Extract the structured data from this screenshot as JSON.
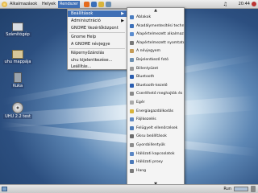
{
  "top_panel": {
    "menus": [
      "Alkalmazások",
      "Helyek",
      "Rendszer"
    ],
    "clock": "20:44"
  },
  "desktop_icons": [
    {
      "label": "Számítógép",
      "icon": "computer-icon"
    },
    {
      "label": "uhu mappája",
      "icon": "home-folder-icon"
    },
    {
      "label": "Kuka",
      "icon": "trash-icon"
    },
    {
      "label": "UHU 2.2 test",
      "icon": "cd-disc-icon"
    }
  ],
  "system_menu": {
    "items": [
      "Beállítások",
      "Adminisztráció",
      "GNOME Vezérlőközpont",
      "Gnome Help",
      "A GNOME névjegye",
      "Képernyőzárolás",
      "uhu kijelentkezése...",
      "Leállítás..."
    ],
    "highlighted_index": 0
  },
  "preferences_menu": {
    "items": [
      {
        "label": "Ablakok",
        "icon": "windows-icon",
        "color": "#4a7cc0"
      },
      {
        "label": "Akadálymentesítési technológiák",
        "icon": "accessibility-icon",
        "color": "#3b6fb8"
      },
      {
        "label": "Alapértelmezett alkalmazások",
        "icon": "default-apps-icon",
        "color": "#5a8ccf"
      },
      {
        "label": "Alapértelmezett nyomtató",
        "icon": "printer-icon",
        "color": "#777777"
      },
      {
        "label": "A névjegyem",
        "icon": "about-me-icon",
        "color": "#c49b56"
      },
      {
        "label": "Bejelentkező fotó",
        "icon": "login-photo-icon",
        "color": "#6d8fb0"
      },
      {
        "label": "Billentyűzet",
        "icon": "keyboard-icon",
        "color": "#999999"
      },
      {
        "label": "Bluetooth",
        "icon": "bluetooth-icon",
        "color": "#2a5db0"
      },
      {
        "label": "Bluetooth-kezelő",
        "icon": "bluetooth-manager-icon",
        "color": "#2a5db0"
      },
      {
        "label": "Cserélhető meghajtók és adathordozók",
        "icon": "removable-drive-icon",
        "color": "#8a8a8a"
      },
      {
        "label": "Egér",
        "icon": "mouse-icon",
        "color": "#aaaaaa"
      },
      {
        "label": "Energiagazdálkodás",
        "icon": "power-icon",
        "color": "#d9b43a"
      },
      {
        "label": "Fájlkezelés",
        "icon": "file-management-icon",
        "color": "#5f88c2"
      },
      {
        "label": "Felügyelt ellenőrzések",
        "icon": "parental-control-icon",
        "color": "#4f7db8"
      },
      {
        "label": "Gksu beállítások",
        "icon": "gksu-icon",
        "color": "#6b6b6b"
      },
      {
        "label": "Gyorsbillentyűk",
        "icon": "shortcuts-icon",
        "color": "#8c8c8c"
      },
      {
        "label": "Hálózati kapcsolatok",
        "icon": "network-icon",
        "color": "#5a86c4"
      },
      {
        "label": "Hálózati proxy",
        "icon": "proxy-icon",
        "color": "#4a78b8"
      },
      {
        "label": "Hang",
        "icon": "sound-icon",
        "color": "#7a7a7a"
      }
    ]
  },
  "bottom_panel": {
    "workspace_label": "Run"
  }
}
